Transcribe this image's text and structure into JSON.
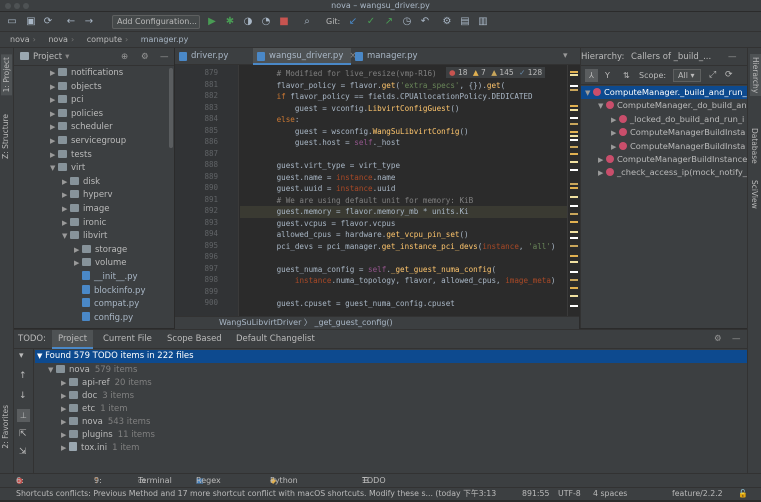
{
  "window": {
    "title": "nova – wangsu_driver.py"
  },
  "toolbar": {
    "add_config": "Add Configuration...",
    "git_label": "Git:"
  },
  "nav": {
    "crumbs": [
      "nova",
      "nova",
      "compute",
      "manager.py"
    ]
  },
  "project": {
    "title": "Project",
    "items": [
      {
        "label": "notifications",
        "type": "folder",
        "level": 2,
        "expanded": false
      },
      {
        "label": "objects",
        "type": "folder",
        "level": 2,
        "expanded": false
      },
      {
        "label": "pci",
        "type": "folder",
        "level": 2,
        "expanded": false
      },
      {
        "label": "policies",
        "type": "folder",
        "level": 2,
        "expanded": false
      },
      {
        "label": "scheduler",
        "type": "folder",
        "level": 2,
        "expanded": false
      },
      {
        "label": "servicegroup",
        "type": "folder",
        "level": 2,
        "expanded": false
      },
      {
        "label": "tests",
        "type": "folder",
        "level": 2,
        "expanded": false
      },
      {
        "label": "virt",
        "type": "folder",
        "level": 2,
        "expanded": true
      },
      {
        "label": "disk",
        "type": "folder",
        "level": 3,
        "expanded": false
      },
      {
        "label": "hyperv",
        "type": "folder",
        "level": 3,
        "expanded": false
      },
      {
        "label": "image",
        "type": "folder",
        "level": 3,
        "expanded": false
      },
      {
        "label": "ironic",
        "type": "folder",
        "level": 3,
        "expanded": false
      },
      {
        "label": "libvirt",
        "type": "folder",
        "level": 3,
        "expanded": true
      },
      {
        "label": "storage",
        "type": "folder",
        "level": 4,
        "expanded": false
      },
      {
        "label": "volume",
        "type": "folder",
        "level": 4,
        "expanded": false
      },
      {
        "label": "__init__.py",
        "type": "file",
        "level": 4
      },
      {
        "label": "blockinfo.py",
        "type": "file",
        "level": 4
      },
      {
        "label": "compat.py",
        "type": "file",
        "level": 4
      },
      {
        "label": "config.py",
        "type": "file",
        "level": 4
      }
    ]
  },
  "tabs": [
    {
      "label": "driver.py",
      "active": false
    },
    {
      "label": "wangsu_driver.py",
      "active": true
    },
    {
      "label": "manager.py",
      "active": false
    }
  ],
  "inspections": {
    "errors": "18",
    "warnings": "7",
    "weak": "145",
    "typos": "128"
  },
  "editor": {
    "line_numbers": [
      "879",
      "881",
      "882",
      "883",
      "884",
      "885",
      "886",
      "887",
      "888",
      "889",
      "890",
      "891",
      "892",
      "893",
      "894",
      "895",
      "896",
      "897",
      "898",
      "899",
      "900"
    ],
    "lines": [
      [
        {
          "t": "        # Modified for live_resize(vmp-R16)",
          "c": "cm"
        }
      ],
      [
        {
          "t": "        flavor_policy = flavor.",
          "c": ""
        },
        {
          "t": "get",
          "c": "fn"
        },
        {
          "t": "(",
          "c": ""
        },
        {
          "t": "'extra_specs'",
          "c": "st"
        },
        {
          "t": ", {}).",
          "c": ""
        },
        {
          "t": "get",
          "c": "fn"
        },
        {
          "t": "(",
          "c": ""
        }
      ],
      [
        {
          "t": "        ",
          "c": ""
        },
        {
          "t": "if",
          "c": "kw"
        },
        {
          "t": " flavor_policy == fields.CPUAllocationPolicy.DEDICATED",
          "c": ""
        }
      ],
      [
        {
          "t": "            guest = vconfig.",
          "c": ""
        },
        {
          "t": "LibvirtConfigGuest",
          "c": "fn"
        },
        {
          "t": "()",
          "c": ""
        }
      ],
      [
        {
          "t": "        ",
          "c": ""
        },
        {
          "t": "else",
          "c": "kw"
        },
        {
          "t": ":",
          "c": ""
        }
      ],
      [
        {
          "t": "            guest = wsconfig.",
          "c": ""
        },
        {
          "t": "WangSuLibvirtConfig",
          "c": "fn"
        },
        {
          "t": "()",
          "c": ""
        }
      ],
      [
        {
          "t": "            guest.host = ",
          "c": ""
        },
        {
          "t": "self",
          "c": "sf"
        },
        {
          "t": "._host",
          "c": ""
        }
      ],
      [
        {
          "t": "",
          "c": ""
        }
      ],
      [
        {
          "t": "        guest.virt_type = virt_type",
          "c": ""
        }
      ],
      [
        {
          "t": "        guest.name = ",
          "c": ""
        },
        {
          "t": "instance",
          "c": "pm"
        },
        {
          "t": ".name",
          "c": ""
        }
      ],
      [
        {
          "t": "        guest.uuid = ",
          "c": ""
        },
        {
          "t": "instance",
          "c": "pm"
        },
        {
          "t": ".uuid",
          "c": ""
        }
      ],
      [
        {
          "t": "        # We are using default unit for memory: KiB",
          "c": "cm"
        }
      ],
      [
        {
          "t": "        guest.memory = flavor.memory_mb * units.Ki",
          "c": ""
        }
      ],
      [
        {
          "t": "        guest.vcpus = flavor.vcpus",
          "c": ""
        }
      ],
      [
        {
          "t": "        allowed_cpus = hardware.",
          "c": ""
        },
        {
          "t": "get_vcpu_pin_set",
          "c": "fn"
        },
        {
          "t": "()",
          "c": ""
        }
      ],
      [
        {
          "t": "        pci_devs = pci_manager.",
          "c": ""
        },
        {
          "t": "get_instance_pci_devs",
          "c": "fn"
        },
        {
          "t": "(",
          "c": ""
        },
        {
          "t": "instance",
          "c": "pm"
        },
        {
          "t": ", ",
          "c": ""
        },
        {
          "t": "'all'",
          "c": "st"
        },
        {
          "t": ")",
          "c": ""
        }
      ],
      [
        {
          "t": "",
          "c": ""
        }
      ],
      [
        {
          "t": "        guest_numa_config = ",
          "c": ""
        },
        {
          "t": "self",
          "c": "sf"
        },
        {
          "t": ".",
          "c": ""
        },
        {
          "t": "_get_guest_numa_config",
          "c": "fn"
        },
        {
          "t": "(",
          "c": ""
        }
      ],
      [
        {
          "t": "            ",
          "c": ""
        },
        {
          "t": "instance",
          "c": "pm"
        },
        {
          "t": ".numa_topology, flavor, allowed_cpus, ",
          "c": ""
        },
        {
          "t": "image_meta",
          "c": "pm"
        },
        {
          "t": ")",
          "c": ""
        }
      ],
      [
        {
          "t": "",
          "c": ""
        }
      ],
      [
        {
          "t": "        guest.cpuset = guest_numa_config.cpuset",
          "c": ""
        }
      ]
    ],
    "highlight_line_index": 12,
    "breadcrumb": "WangSuLibvirtDriver  〉 _get_guest_config()"
  },
  "hierarchy": {
    "title": "Hierarchy:",
    "caller_title": "Callers of _build_...",
    "scope_label": "Scope:",
    "scope_value": "All",
    "items": [
      {
        "label": "ComputeManager._build_and_run_",
        "level": 0,
        "selected": true,
        "expanded": true
      },
      {
        "label": "ComputeManager._do_build_and_",
        "level": 1,
        "selected": false,
        "expanded": true
      },
      {
        "label": "_locked_do_build_and_run_i",
        "level": 2,
        "selected": false,
        "expanded": false
      },
      {
        "label": "ComputeManagerBuildInsta",
        "level": 2,
        "selected": false,
        "expanded": false
      },
      {
        "label": "ComputeManagerBuildInsta",
        "level": 2,
        "selected": false,
        "expanded": false
      },
      {
        "label": "ComputeManagerBuildInstance",
        "level": 1,
        "selected": false,
        "expanded": false
      },
      {
        "label": "_check_access_ip(mock_notify_",
        "level": 1,
        "selected": false,
        "expanded": false
      }
    ]
  },
  "todo": {
    "title": "TODO:",
    "tabs": [
      "Project",
      "Current File",
      "Scope Based",
      "Default Changelist"
    ],
    "summary": "Found 579 TODO items in 222 files",
    "items": [
      {
        "label": "nova",
        "count": "579 items",
        "level": 1,
        "type": "folder",
        "expanded": true
      },
      {
        "label": "api-ref",
        "count": "20 items",
        "level": 2,
        "type": "folder",
        "expanded": false
      },
      {
        "label": "doc",
        "count": "3 items",
        "level": 2,
        "type": "folder",
        "expanded": false
      },
      {
        "label": "etc",
        "count": "1 item",
        "level": 2,
        "type": "folder",
        "expanded": false
      },
      {
        "label": "nova",
        "count": "543 items",
        "level": 2,
        "type": "folder",
        "expanded": false
      },
      {
        "label": "plugins",
        "count": "11 items",
        "level": 2,
        "type": "folder",
        "expanded": false
      },
      {
        "label": "tox.ini",
        "count": "1 item",
        "level": 2,
        "type": "file",
        "expanded": false
      }
    ]
  },
  "left_tools": {
    "project": "1: Project",
    "structure": "Z: Structure",
    "favorites": "2: Favorites"
  },
  "right_tools": {
    "hierarchy": "Hierarchy",
    "database": "Database",
    "sciview": "SciView"
  },
  "bottom_tools": [
    "6: Problems",
    "9: Git",
    "Terminal",
    "Regex Tester",
    "Python Console",
    "TODO"
  ],
  "status": {
    "message": "Shortcuts conflicts: Previous Method and 17 more shortcut conflict with macOS shortcuts. Modify these s... (today 下午3:13)",
    "position": "891:55",
    "encoding": "UTF-8",
    "indent": "4 spaces",
    "branch": "feature/2.2.2"
  },
  "colors": {
    "accent": "#4a88c7",
    "selection": "#0d4a8f",
    "bg": "#2b2b2b",
    "panel": "#3c3f41"
  }
}
